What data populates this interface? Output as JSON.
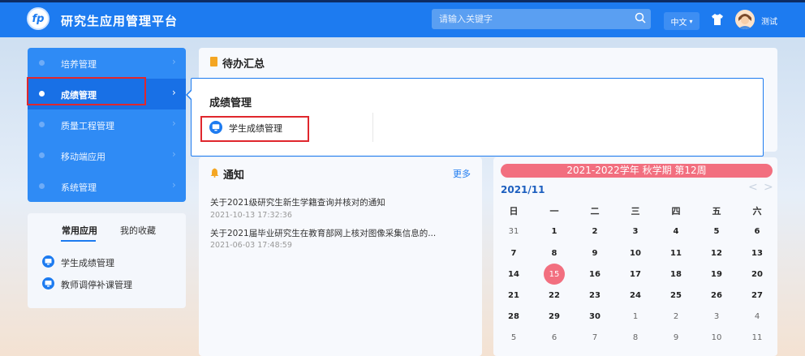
{
  "header": {
    "logo_text": "fp",
    "title": "研究生应用管理平台",
    "search_placeholder": "请输入关键字",
    "lang": "中文",
    "username": "测试"
  },
  "nav": {
    "items": [
      {
        "label": "培养管理"
      },
      {
        "label": "成绩管理"
      },
      {
        "label": "质量工程管理"
      },
      {
        "label": "移动端应用"
      },
      {
        "label": "系统管理"
      }
    ]
  },
  "common_apps": {
    "tabs": [
      "常用应用",
      "我的收藏"
    ],
    "apps": [
      "学生成绩管理",
      "教师调停补课管理"
    ]
  },
  "todo": {
    "title": "待办汇总"
  },
  "flyout": {
    "title": "成绩管理",
    "link": "学生成绩管理"
  },
  "notice": {
    "title": "通知",
    "more": "更多",
    "items": [
      {
        "title": "关于2021级研究生新生学籍查询并核对的通知",
        "date": "2021-10-13 17:32:36"
      },
      {
        "title": "关于2021届毕业研究生在教育部网上核对图像采集信息的...",
        "date": "2021-06-03 17:48:59"
      }
    ]
  },
  "calendar": {
    "term": "2021-2022学年 秋学期 第12周",
    "month": "2021/11",
    "prev": "<",
    "next": ">",
    "weekdays": [
      "日",
      "一",
      "二",
      "三",
      "四",
      "五",
      "六"
    ],
    "weeks": [
      [
        "31",
        "1",
        "2",
        "3",
        "4",
        "5",
        "6"
      ],
      [
        "7",
        "8",
        "9",
        "10",
        "11",
        "12",
        "13"
      ],
      [
        "14",
        "15",
        "16",
        "17",
        "18",
        "19",
        "20"
      ],
      [
        "21",
        "22",
        "23",
        "24",
        "25",
        "26",
        "27"
      ],
      [
        "28",
        "29",
        "30",
        "1",
        "2",
        "3",
        "4"
      ],
      [
        "5",
        "6",
        "7",
        "8",
        "9",
        "10",
        "11"
      ]
    ],
    "today": "15",
    "colors": {
      "accent": "#1d7bf0",
      "today": "#f26f7f",
      "highlight_box": "#e0272d"
    }
  }
}
